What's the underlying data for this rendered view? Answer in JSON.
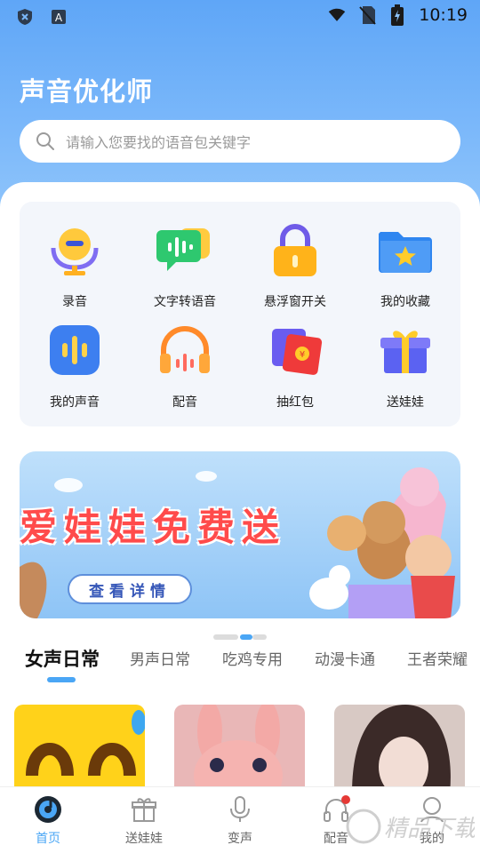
{
  "status_bar": {
    "time": "10:19",
    "icons": [
      "shield-icon",
      "keyboard-a-icon",
      "wifi-icon",
      "no-sim-icon",
      "battery-charging-icon"
    ]
  },
  "app": {
    "title": "声音优化师"
  },
  "search": {
    "placeholder": "请输入您要找的语音包关键字",
    "icon": "search-icon"
  },
  "features": [
    {
      "label": "录音",
      "icon": "recorder-icon"
    },
    {
      "label": "文字转语音",
      "icon": "text-to-speech-icon"
    },
    {
      "label": "悬浮窗开关",
      "icon": "lock-icon"
    },
    {
      "label": "我的收藏",
      "icon": "star-folder-icon"
    },
    {
      "label": "我的声音",
      "icon": "voice-bars-icon"
    },
    {
      "label": "配音",
      "icon": "headphones-icon"
    },
    {
      "label": "抽红包",
      "icon": "red-envelope-icon"
    },
    {
      "label": "送娃娃",
      "icon": "gift-box-icon"
    }
  ],
  "banner": {
    "headline": "爱娃娃免费送",
    "button": "查看详情",
    "page_index": 2,
    "page_count": 2
  },
  "tabs": [
    {
      "label": "女声日常",
      "active": true
    },
    {
      "label": "男声日常",
      "active": false
    },
    {
      "label": "吃鸡专用",
      "active": false
    },
    {
      "label": "动漫卡通",
      "active": false
    },
    {
      "label": "王者荣耀",
      "active": false
    }
  ],
  "thumbnails": [
    "smiley-emoji-image",
    "pink-bunny-plush-image",
    "girl-portrait-image"
  ],
  "bottom_nav": [
    {
      "label": "首页",
      "icon": "music-disc-icon",
      "active": true,
      "badge": false
    },
    {
      "label": "送娃娃",
      "icon": "gift-icon",
      "active": false,
      "badge": false
    },
    {
      "label": "变声",
      "icon": "microphone-icon",
      "active": false,
      "badge": false
    },
    {
      "label": "配音",
      "icon": "headset-icon",
      "active": false,
      "badge": true
    },
    {
      "label": "我的",
      "icon": "profile-icon",
      "active": false,
      "badge": false
    }
  ],
  "watermark": {
    "text": "精品下载"
  },
  "colors": {
    "brand_blue": "#5fa6f7",
    "accent": "#4aa6f5",
    "badge_red": "#e53935"
  }
}
